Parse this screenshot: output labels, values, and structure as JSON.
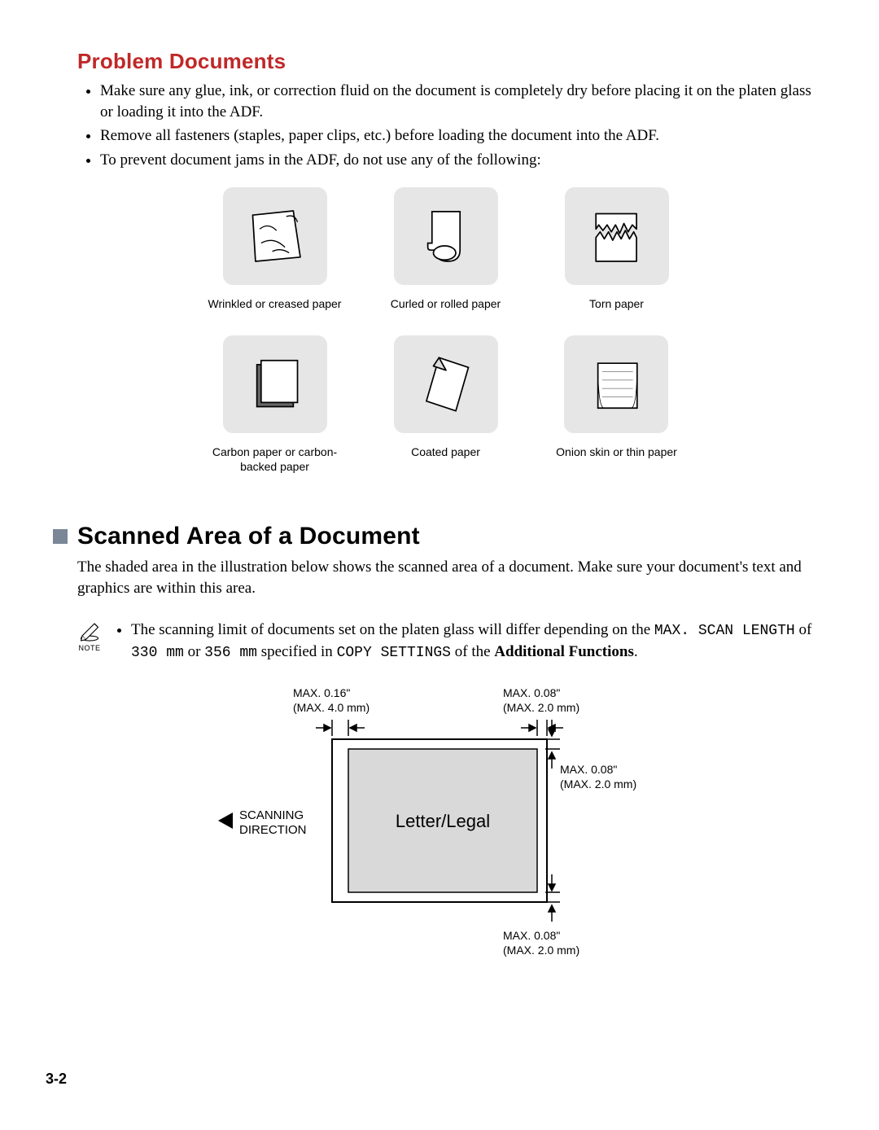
{
  "heading1": "Problem Documents",
  "bullets": {
    "b1": "Make sure any glue, ink, or correction fluid on the document is completely dry before placing it on the platen glass or loading it into the ADF.",
    "b2": "Remove all fasteners (staples, paper clips, etc.) before loading the document into the ADF.",
    "b3": "To prevent document jams in the ADF, do not use any of the following:"
  },
  "paper_types": {
    "wrinkled": "Wrinkled or creased paper",
    "curled": "Curled or rolled paper",
    "torn": "Torn paper",
    "carbon": "Carbon paper or carbon-backed paper",
    "coated": "Coated paper",
    "onion": "Onion skin or thin paper"
  },
  "heading2": "Scanned Area of a Document",
  "section_body": "The shaded area in the illustration below shows the scanned area of a document. Make sure your document's text and graphics are within this area.",
  "note_label": "NOTE",
  "note": {
    "prefix": "The scanning limit of documents set on the platen glass will differ depending on the ",
    "mono1": "MAX. SCAN LENGTH",
    "mid1": " of ",
    "mono2": "330 mm",
    "mid2": " or ",
    "mono3": "356 mm",
    "mid3": " specified in ",
    "mono4": "COPY SETTINGS",
    "mid4": " of the ",
    "bold1": "Additional Functions",
    "suffix": "."
  },
  "diagram": {
    "left_margin_l1": "MAX. 0.16\"",
    "left_margin_l2": "(MAX. 4.0 mm)",
    "right_margin_l1": "MAX. 0.08\"",
    "right_margin_l2": "(MAX. 2.0 mm)",
    "top_margin_l1": "MAX. 0.08\"",
    "top_margin_l2": "(MAX. 2.0 mm)",
    "bottom_margin_l1": "MAX. 0.08\"",
    "bottom_margin_l2": "(MAX. 2.0 mm)",
    "scanning_l1": "SCANNING",
    "scanning_l2": "DIRECTION",
    "center_label": "Letter/Legal"
  },
  "page_number": "3-2"
}
